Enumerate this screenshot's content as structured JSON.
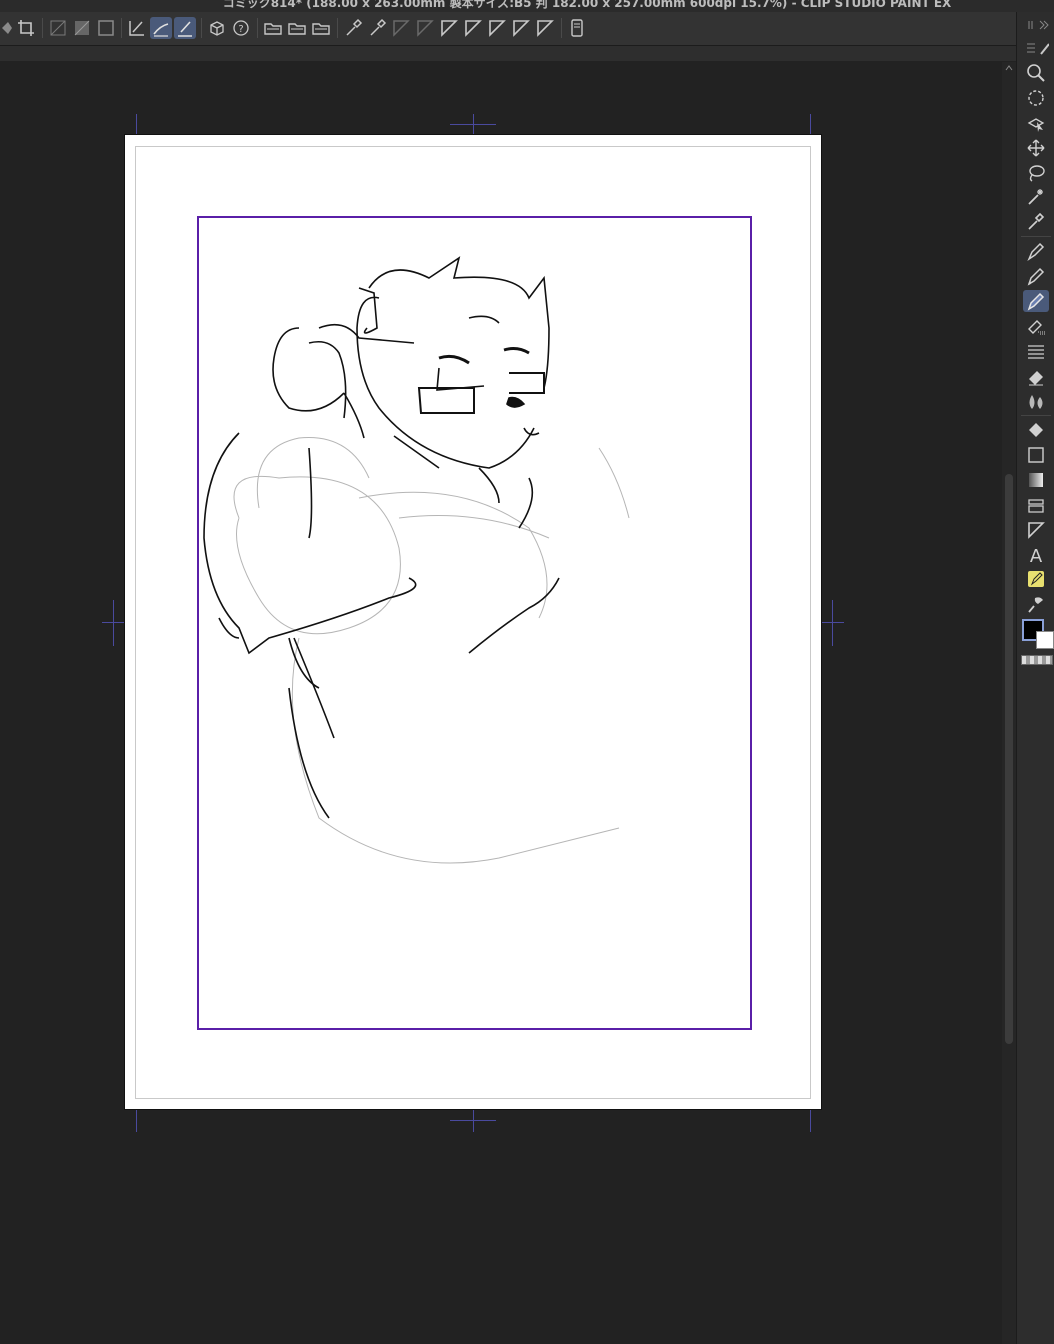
{
  "window": {
    "title": "コミック814* (188.00 x 263.00mm 製本サイズ:B5 判 182.00 x 257.00mm 600dpi 15.7%)  - CLIP STUDIO PAINT EX"
  },
  "command_bar": {
    "icons": [
      "fill-icon",
      "crop-icon",
      "hide-outside-icon",
      "show-outside-icon",
      "frame-icon",
      "pen-rule-icon",
      "curve-rule-icon",
      "straight-rule-icon",
      "3d-icon",
      "help-icon",
      "open-folder-icon",
      "open-folder-icon",
      "open-folder-icon",
      "eyedropper-icon",
      "eyedropper-icon",
      "triangle-ruler-icon",
      "triangle-ruler-icon",
      "triangle-ruler-icon",
      "triangle-ruler-icon",
      "triangle-ruler-icon",
      "triangle-ruler-icon",
      "triangle-ruler-icon",
      "device-icon"
    ],
    "active_icon": "curve-rule-icon"
  },
  "tool_panel": {
    "tools": [
      "zoom-icon",
      "rotate-icon",
      "object-select-icon",
      "move-icon",
      "lasso-icon",
      "magic-wand-icon",
      "eyedropper-icon",
      "pen-icon",
      "pencil-icon",
      "brush-icon",
      "airbrush-icon",
      "decoration-icon",
      "eraser-icon",
      "blend-icon",
      "fill-icon",
      "figure-icon",
      "gradient-icon",
      "frame-border-icon",
      "ruler-icon",
      "text-icon",
      "correction-icon",
      "balloon-icon"
    ],
    "active_tool": "brush-icon",
    "text_tool_glyph": "A",
    "colors": {
      "main": "#000000",
      "sub": "#ffffff",
      "frame_border": "#5a1fa8"
    }
  }
}
